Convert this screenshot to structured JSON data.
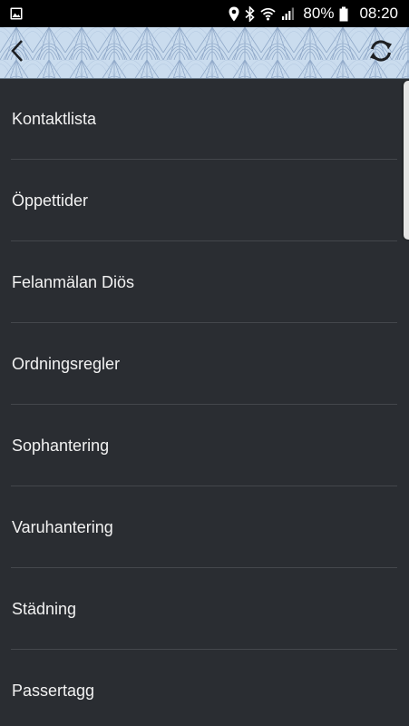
{
  "status_bar": {
    "battery": "80%",
    "time": "08:20",
    "icons": [
      "image-notification-icon",
      "location-icon",
      "bluetooth-icon",
      "wifi-icon",
      "cell-signal-icon",
      "battery-icon"
    ]
  },
  "app_bar": {
    "back_icon": "chevron-left-icon",
    "refresh_icon": "refresh-icon",
    "pattern_color": "#c7d9ec"
  },
  "list": {
    "items": [
      {
        "label": "Kontaktlista"
      },
      {
        "label": "Öppettider"
      },
      {
        "label": "Felanmälan Diös"
      },
      {
        "label": "Ordningsregler"
      },
      {
        "label": "Sophantering"
      },
      {
        "label": "Varuhantering"
      },
      {
        "label": "Städning"
      },
      {
        "label": "Passertagg"
      }
    ]
  },
  "colors": {
    "background": "#2a2d32",
    "text": "#f2f2f2",
    "divider": "#44474c"
  }
}
